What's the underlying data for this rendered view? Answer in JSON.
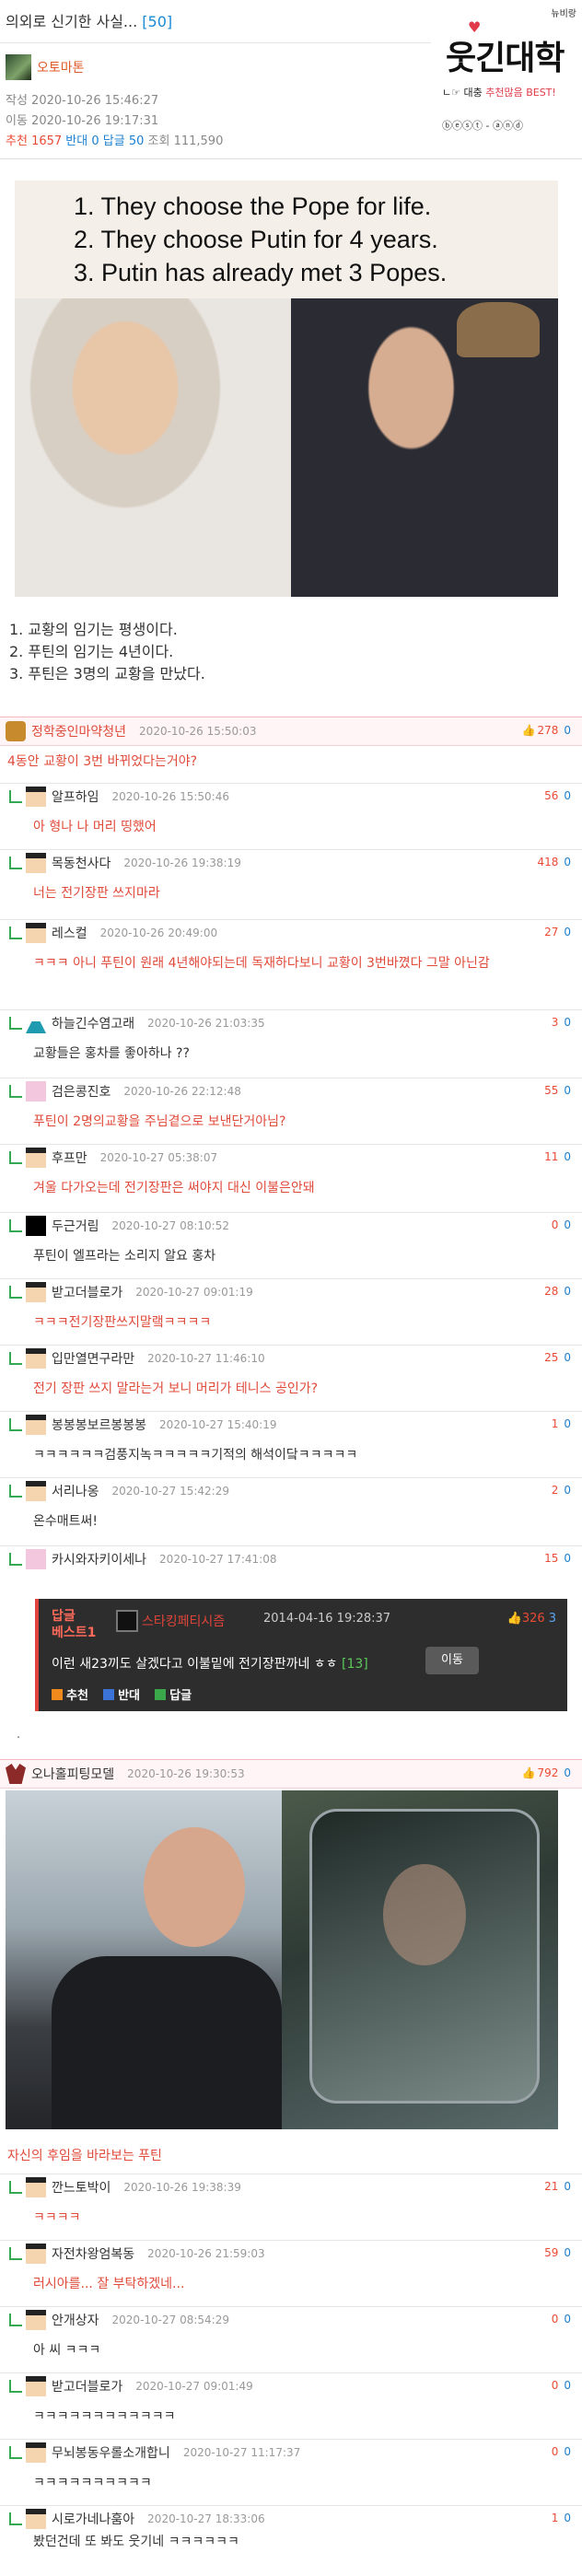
{
  "post": {
    "title": "의외로 신기한 사실...",
    "comment_count": "[50]",
    "author": "오토마톤",
    "created": "작성 2020-10-26 15:46:27",
    "moved": "이동 2020-10-26 19:17:31",
    "stats": {
      "rec_label": "추천",
      "rec": "1657",
      "opp_label": "반대",
      "opp": "0",
      "reply_label": "답글",
      "reply": "50",
      "view_label": "조회",
      "view": "111,590"
    },
    "image_lines": [
      "1. They choose the Pope for life.",
      "2. They choose Putin for 4 years.",
      "3. Putin has already met 3 Popes."
    ],
    "summary": [
      "1. 교황의 임기는 평생이다.",
      "2. 푸틴의 임기는 4년이다.",
      "3. 푸틴은 3명의 교황을 만났다."
    ]
  },
  "logo": {
    "small": "뉴비랑",
    "main": "웃긴대학",
    "sub_prefix": "ㄴ☞ 대충",
    "sub_highlight": "추천많음 BEST!",
    "links": "ⓑⓔⓢⓣ - ⓐⓝⓓ"
  },
  "comments": [
    {
      "name": "정학중인마약청년",
      "date": "2020-10-26 15:50:03",
      "up": "278",
      "down": "0",
      "text": "4동안 교황이 3번 바뀌었다는거야?",
      "thumb": true
    },
    {
      "name": "알프하임",
      "date": "2020-10-26 15:50:46",
      "up": "56",
      "down": "0",
      "text": "아 형나 나 머리 띵했어"
    },
    {
      "name": "목동천사다",
      "date": "2020-10-26 19:38:19",
      "up": "418",
      "down": "0",
      "text": "너는 전기장판 쓰지마라"
    },
    {
      "name": "레스컬",
      "date": "2020-10-26 20:49:00",
      "up": "27",
      "down": "0",
      "text": "ㅋㅋㅋ 아니 푸틴이 원래 4년해야되는데 독재하다보니 교황이 3번바꼈다 그말 아닌감"
    },
    {
      "name": "하늘긴수염고래",
      "date": "2020-10-26 21:03:35",
      "up": "3",
      "down": "0",
      "text": "교황들은 홍차를 좋아하나 ??"
    },
    {
      "name": "검은콩진호",
      "date": "2020-10-26 22:12:48",
      "up": "55",
      "down": "0",
      "text": "푸틴이 2명의교황을 주님곁으로 보낸단거아님?"
    },
    {
      "name": "후프만",
      "date": "2020-10-27 05:38:07",
      "up": "11",
      "down": "0",
      "text": "겨울 다가오는데 전기장판은 써야지 대신 이불은안돼"
    },
    {
      "name": "두근거림",
      "date": "2020-10-27 08:10:52",
      "up": "0",
      "down": "0",
      "text": "푸틴이 엘프라는 소리지 알요 홍차"
    },
    {
      "name": "받고더블로가",
      "date": "2020-10-27 09:01:19",
      "up": "28",
      "down": "0",
      "text": "ㅋㅋㅋ전기장판쓰지말랰ㅋㅋㅋㅋ"
    },
    {
      "name": "입만열면구라만",
      "date": "2020-10-27 11:46:10",
      "up": "25",
      "down": "0",
      "text": "전기 장판 쓰지 말라는거 보니 머리가 테니스 공인가?"
    },
    {
      "name": "봉봉봉보르봉봉봉",
      "date": "2020-10-27 15:40:19",
      "up": "1",
      "down": "0",
      "text": "ㅋㅋㅋㅋㅋㅋ검풍지녹ㅋㅋㅋㅋㅋ기적의 해석이닼ㅋㅋㅋㅋㅋ"
    },
    {
      "name": "서리나옹",
      "date": "2020-10-27 15:42:29",
      "up": "2",
      "down": "0",
      "text": "온수매트써!"
    },
    {
      "name": "카시와자키이세나",
      "date": "2020-10-27 17:41:08",
      "up": "15",
      "down": "0",
      "text": ""
    }
  ],
  "best_reply": {
    "tag_line1": "답글",
    "tag_line2": "베스트1",
    "name": "스타킹페티시즘",
    "date": "2014-04-16 19:28:37",
    "up": "326",
    "down": "3",
    "text": "이런 새23끼도 살겠다고 이불밑에 전기장판까네 ㅎㅎ",
    "count": "[13]",
    "go": "이동",
    "act_rec": "추천",
    "act_opp": "반대",
    "act_reply": "답글"
  },
  "dot": ".",
  "comments2": [
    {
      "name": "오나홀피팅모델",
      "date": "2020-10-26 19:30:53",
      "up": "792",
      "down": "0",
      "text": "자신의 후임을 바라보는 푸틴",
      "thumb": true
    },
    {
      "name": "깐느토박이",
      "date": "2020-10-26 19:38:39",
      "up": "21",
      "down": "0",
      "text": "ㅋㅋㅋㅋ"
    },
    {
      "name": "자전차왕엄복동",
      "date": "2020-10-26 21:59:03",
      "up": "59",
      "down": "0",
      "text": "러시아를... 잘 부탁하겠네..."
    },
    {
      "name": "안개상자",
      "date": "2020-10-27 08:54:29",
      "up": "0",
      "down": "0",
      "text": "아 씨 ㅋㅋㅋ"
    },
    {
      "name": "받고더블로가",
      "date": "2020-10-27 09:01:49",
      "up": "0",
      "down": "0",
      "text": "ㅋㅋㅋㅋㅋㅋㅋㅋㅋㅋㅋㅋ"
    },
    {
      "name": "무뇌봉동우롤소개합니",
      "date": "2020-10-27 11:17:37",
      "up": "0",
      "down": "0",
      "text": "ㅋㅋㅋㅋㅋㅋㅋㅋㅋㅋ"
    },
    {
      "name": "시로가네나훔아",
      "date": "2020-10-27 18:33:06",
      "up": "1",
      "down": "0",
      "text": "봤던건데 또 봐도 웃기네 ㅋㅋㅋㅋㅋㅋ"
    }
  ]
}
